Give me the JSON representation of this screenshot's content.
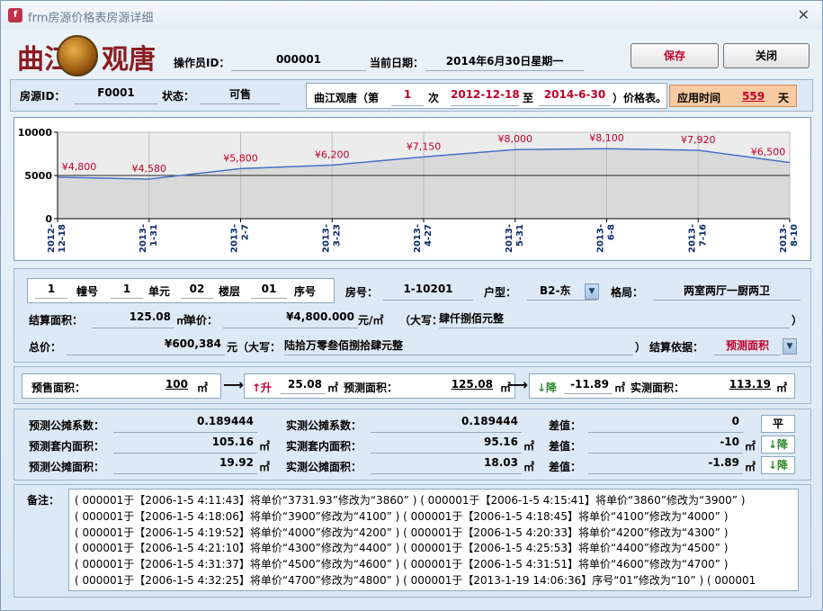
{
  "window": {
    "title": "frm房源价格表房源详细",
    "close_glyph": "✕"
  },
  "header": {
    "logo_left": "曲江",
    "logo_right": "观唐",
    "operator_label": "操作员ID：",
    "operator_value": "000001",
    "date_label": "当前日期：",
    "date_value": "2014年6月30日星期一",
    "save_label": "保存",
    "close_label": "关闭"
  },
  "info_bar": {
    "house_id_label": "房源ID：",
    "house_id_value": "F0001",
    "status_label": "状态：",
    "status_value": "可售",
    "project_label": "曲江观唐（第",
    "period_value": "1",
    "period_suffix": "次",
    "start_date": "2012-12-18",
    "to_label": "至",
    "end_date": "2014-6-30",
    "price_table_label": "）价格表。",
    "apply_time_label": "应用时间",
    "apply_time_value": "559",
    "apply_time_unit": "天"
  },
  "chart_data": {
    "type": "area",
    "x": [
      "2012-12-18",
      "2013-1-31",
      "2013-2-7",
      "2013-3-23",
      "2013-4-27",
      "2013-5-31",
      "2013-6-8",
      "2013-7-16",
      "2013-8-10"
    ],
    "values": [
      4800,
      4580,
      5800,
      6200,
      7150,
      8000,
      8100,
      7920,
      6500
    ],
    "data_labels": [
      "¥4,800",
      "¥4,580",
      "¥5,800",
      "¥6,200",
      "¥7,150",
      "¥8,000",
      "¥8,100",
      "¥7,920",
      "¥6,500"
    ],
    "ylim": [
      0,
      10000
    ],
    "yticks": [
      "0",
      "5000",
      "10000"
    ],
    "reference_line": 5000,
    "grid": true,
    "colors": {
      "area": "#d9d9d9",
      "line": "#4472c4",
      "label": "#c0002a"
    }
  },
  "room": {
    "building_value": "1",
    "building_label": "幢号",
    "unit_value": "1",
    "unit_label": "单元",
    "floor_value": "02",
    "floor_label": "楼层",
    "seq_value": "01",
    "seq_label": "序号",
    "room_no_label": "房号：",
    "room_no_value": "1-10201",
    "type_label": "户型：",
    "type_value": "B2-东",
    "layout_label": "格局：",
    "layout_value": "两室两厅一厨两卫",
    "settle_area_label": "结算面积：",
    "settle_area_value": "125.08",
    "area_unit": "㎡",
    "unit_price_label": "单价：",
    "unit_price_value": "¥4,800.000",
    "unit_price_unit": "元/㎡",
    "upper_label": "（大写：",
    "unit_price_upper": "肆仟捌佰元整",
    "close_paren": "）",
    "total_label": "总价：",
    "total_value": "¥600,384",
    "total_unit": "元（大写：",
    "total_upper": "陆拾万零叁佰捌拾肆元整",
    "settle_basis_label": "结算依据：",
    "settle_basis_value": "预测面积"
  },
  "area_flow": {
    "presale_label": "预售面积：",
    "presale_value": "100",
    "unit": "㎡",
    "arrow": "⟶",
    "rise_label": "↑升",
    "rise_value": "25.08",
    "forecast_label": "预测面积：",
    "forecast_value": "125.08",
    "fall_label": "↓降",
    "fall_value": "-11.89",
    "actual_label": "实测面积：",
    "actual_value": "113.19"
  },
  "stats": {
    "rows": [
      {
        "l1": "预测公摊系数：",
        "v1": "0.189444",
        "u1": "",
        "l2": "实测公摊系数：",
        "v2": "0.189444",
        "u2": "",
        "l3": "差值：",
        "v3": "0",
        "u3": "",
        "btn": "平",
        "btn_color": "#000000"
      },
      {
        "l1": "预测套内面积：",
        "v1": "105.16",
        "u1": "㎡",
        "l2": "实测套内面积：",
        "v2": "95.16",
        "u2": "㎡",
        "l3": "差值：",
        "v3": "-10",
        "u3": "㎡",
        "btn": "↓降",
        "btn_color": "#2d8a2d"
      },
      {
        "l1": "预测公摊面积：",
        "v1": "19.92",
        "u1": "㎡",
        "l2": "实测公摊面积：",
        "v2": "18.03",
        "u2": "㎡",
        "l3": "差值：",
        "v3": "-1.89",
        "u3": "㎡",
        "btn": "↓降",
        "btn_color": "#2d8a2d"
      }
    ]
  },
  "remarks": {
    "label": "备注：",
    "lines": [
      "( 000001于【2006-1-5 4:11:43】将单价“3731.93”修改为“3860” ) ( 000001于【2006-1-5 4:15:41】将单价“3860”修改为“3900” )",
      "( 000001于【2006-1-5 4:18:06】将单价“3900”修改为“4100” ) ( 000001于【2006-1-5 4:18:45】将单价“4100”修改为“4000” )",
      "( 000001于【2006-1-5 4:19:52】将单价“4000”修改为“4200” ) ( 000001于【2006-1-5 4:20:33】将单价“4200”修改为“4300” )",
      "( 000001于【2006-1-5 4:21:10】将单价“4300”修改为“4400” ) ( 000001于【2006-1-5 4:25:53】将单价“4400”修改为“4500” )",
      "( 000001于【2006-1-5 4:31:37】将单价“4500”修改为“4600” ) ( 000001于【2006-1-5 4:31:51】将单价“4600”修改为“4700” )",
      "( 000001于【2006-1-5 4:32:25】将单价“4700”修改为“4800” ) ( 000001于【2013-1-19 14:06:36】序号“01”修改为“10” ) ( 000001"
    ]
  }
}
